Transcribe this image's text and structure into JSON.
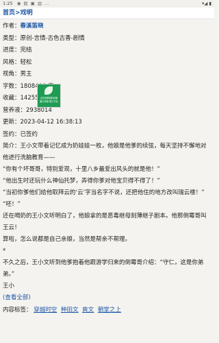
{
  "status_bar": {
    "time": "1:25",
    "icons": "◉ ▤ ▣ ▥ …",
    "signal": "▾◢ ▮"
  },
  "breadcrumb": {
    "home": "首页",
    "separator": ">",
    "current": "戏明"
  },
  "meta": {
    "author_label": "作者：",
    "author": "春溪笛晓",
    "type": "类型：原创-言情-古色古香-剧情",
    "progress": "进度：完结",
    "style": "风格：轻松",
    "view": "视角：男主",
    "words": "字数：1808488 字",
    "favorites": "收藏：142559",
    "nutrition": "营养液：2938014",
    "updated": "更新：2023-04-12 16:38:13",
    "signed": "签约：已签约"
  },
  "cover": {
    "line1": "点击查看新的封面",
    "line2": "图片来源-晋江平台"
  },
  "intro": {
    "p1": "简介：王小文带着记忆成为奶娃娃一枚，他娘是他爹的续弦，每天坚持不懈地对他进行洗脑教育——",
    "p2": "“你有个坏哥哥，特别爱现，十里八乡最爱出风头的就是他！”",
    "p3": "“他出生时还玩什么神仙托梦，弄得你爹对他宝贝得不得了！”",
    "p4": "“当初你爹他们给他取拜云的‘云’字当名字不说，还把他住的地方改叫瑞云楼！”",
    "p5": "“呸！”",
    "p6": "还在喝奶的王小文听明白了，他娘拿的是恶毒继母刻薄继子剧本。他那倒霉哥叫王云！",
    "p7": "算啦，怎么说都是自己亲娘，当然是帮亲不帮理。",
    "p8": "*",
    "p9": "不久之后，王小文听到他爹抱着他跟游学归来的倒霉哥介绍：“守仁，这是你弟弟。”",
    "p10": "王小"
  },
  "more_link": "(查看全部)",
  "tags": {
    "label": "内容标签：",
    "items": [
      "穿越时空",
      "种田文",
      "爽文",
      "朝堂之上"
    ]
  }
}
